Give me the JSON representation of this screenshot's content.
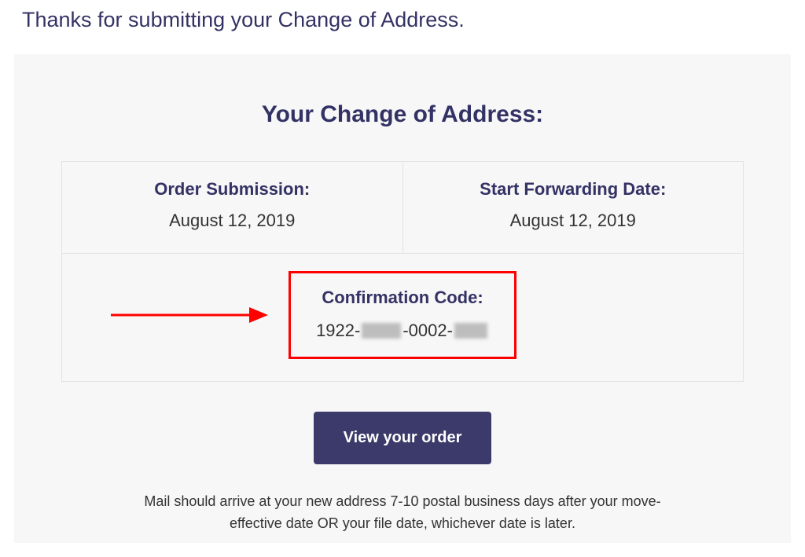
{
  "heading": "Thanks for submitting your Change of Address.",
  "panel": {
    "title": "Your Change of Address:",
    "order_submission": {
      "label": "Order Submission:",
      "value": "August 12, 2019"
    },
    "start_forwarding": {
      "label": "Start Forwarding Date:",
      "value": "August 12, 2019"
    },
    "confirmation": {
      "label": "Confirmation Code:",
      "part1": "1922-",
      "part2": "-0002-"
    },
    "cta_label": "View your order",
    "footnote": "Mail should arrive at your new address 7-10 postal business days after your move-effective date OR your file date, whichever date is later."
  }
}
